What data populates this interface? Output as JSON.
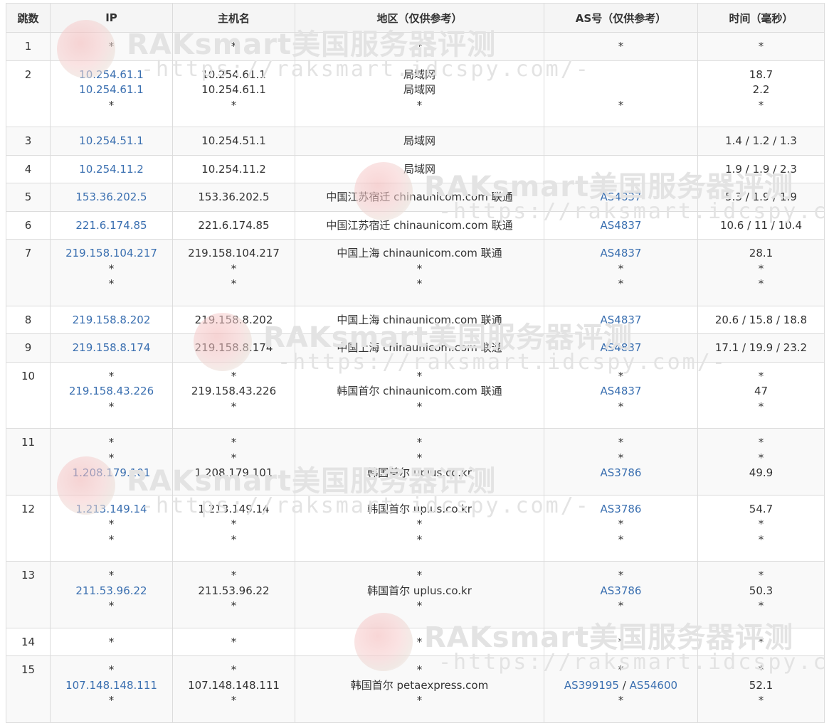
{
  "headers": [
    "跳数",
    "IP",
    "主机名",
    "地区（仅供参考）",
    "AS号（仅供参考）",
    "时间（毫秒）"
  ],
  "watermark": {
    "title": "RAKsmart美国服务器评测",
    "url": "-https://raksmart.idcspy.com/-"
  },
  "rows": [
    {
      "hop": "1",
      "ip": [
        "*"
      ],
      "host": [
        "*"
      ],
      "region": [
        "*"
      ],
      "as": [
        [
          "*"
        ]
      ],
      "time": [
        "*"
      ]
    },
    {
      "hop": "2",
      "ip": [
        "10.254.61.1",
        "10.254.61.1",
        "*"
      ],
      "host": [
        "10.254.61.1",
        "10.254.61.1",
        "*"
      ],
      "region": [
        "局域网",
        "局域网",
        "*"
      ],
      "as": [
        [
          ""
        ],
        [
          ""
        ],
        [
          "*"
        ]
      ],
      "time": [
        "18.7",
        "2.2",
        "*"
      ]
    },
    {
      "hop": "3",
      "ip": [
        "10.254.51.1"
      ],
      "host": [
        "10.254.51.1"
      ],
      "region": [
        "局域网"
      ],
      "as": [
        [
          ""
        ]
      ],
      "time": [
        "1.4 / 1.2 / 1.3"
      ]
    },
    {
      "hop": "4",
      "ip": [
        "10.254.11.2"
      ],
      "host": [
        "10.254.11.2"
      ],
      "region": [
        "局域网"
      ],
      "as": [
        [
          ""
        ]
      ],
      "time": [
        "1.9 / 1.9 / 2.3"
      ]
    },
    {
      "hop": "5",
      "ip": [
        "153.36.202.5"
      ],
      "host": [
        "153.36.202.5"
      ],
      "region": [
        "中国江苏宿迁 chinaunicom.com 联通"
      ],
      "as": [
        [
          "AS4837"
        ]
      ],
      "time": [
        "5.3 / 1.9 / 1.9"
      ]
    },
    {
      "hop": "6",
      "ip": [
        "221.6.174.85"
      ],
      "host": [
        "221.6.174.85"
      ],
      "region": [
        "中国江苏宿迁 chinaunicom.com 联通"
      ],
      "as": [
        [
          "AS4837"
        ]
      ],
      "time": [
        "10.6 / 11 / 10.4"
      ]
    },
    {
      "hop": "7",
      "ip": [
        "219.158.104.217",
        "*",
        "*"
      ],
      "host": [
        "219.158.104.217",
        "*",
        "*"
      ],
      "region": [
        "中国上海 chinaunicom.com 联通",
        "*",
        "*"
      ],
      "as": [
        [
          "AS4837"
        ],
        [
          "*"
        ],
        [
          "*"
        ]
      ],
      "time": [
        "28.1",
        "*",
        "*"
      ]
    },
    {
      "hop": "8",
      "ip": [
        "219.158.8.202"
      ],
      "host": [
        "219.158.8.202"
      ],
      "region": [
        "中国上海 chinaunicom.com 联通"
      ],
      "as": [
        [
          "AS4837"
        ]
      ],
      "time": [
        "20.6 / 15.8 / 18.8"
      ]
    },
    {
      "hop": "9",
      "ip": [
        "219.158.8.174"
      ],
      "host": [
        "219.158.8.174"
      ],
      "region": [
        "中国上海 chinaunicom.com 联通"
      ],
      "as": [
        [
          "AS4837"
        ]
      ],
      "time": [
        "17.1 / 19.9 / 23.2"
      ]
    },
    {
      "hop": "10",
      "ip": [
        "*",
        "219.158.43.226",
        "*"
      ],
      "host": [
        "*",
        "219.158.43.226",
        "*"
      ],
      "region": [
        "*",
        "韩国首尔 chinaunicom.com 联通",
        "*"
      ],
      "as": [
        [
          "*"
        ],
        [
          "AS4837"
        ],
        [
          "*"
        ]
      ],
      "time": [
        "*",
        "47",
        "*"
      ]
    },
    {
      "hop": "11",
      "ip": [
        "*",
        "*",
        "1.208.179.101"
      ],
      "host": [
        "*",
        "*",
        "1.208.179.101"
      ],
      "region": [
        "*",
        "*",
        "韩国首尔 uplus.co.kr"
      ],
      "as": [
        [
          "*"
        ],
        [
          "*"
        ],
        [
          "AS3786"
        ]
      ],
      "time": [
        "*",
        "*",
        "49.9"
      ]
    },
    {
      "hop": "12",
      "ip": [
        "1.213.149.14",
        "*",
        "*"
      ],
      "host": [
        "1.213.149.14",
        "*",
        "*"
      ],
      "region": [
        "韩国首尔 uplus.co.kr",
        "*",
        "*"
      ],
      "as": [
        [
          "AS3786"
        ],
        [
          "*"
        ],
        [
          "*"
        ]
      ],
      "time": [
        "54.7",
        "*",
        "*"
      ]
    },
    {
      "hop": "13",
      "ip": [
        "*",
        "211.53.96.22",
        "*"
      ],
      "host": [
        "*",
        "211.53.96.22",
        "*"
      ],
      "region": [
        "*",
        "韩国首尔 uplus.co.kr",
        "*"
      ],
      "as": [
        [
          "*"
        ],
        [
          "AS3786"
        ],
        [
          "*"
        ]
      ],
      "time": [
        "*",
        "50.3",
        "*"
      ]
    },
    {
      "hop": "14",
      "ip": [
        "*"
      ],
      "host": [
        "*"
      ],
      "region": [
        "*"
      ],
      "as": [
        [
          "*"
        ]
      ],
      "time": [
        "*"
      ]
    },
    {
      "hop": "15",
      "ip": [
        "*",
        "107.148.148.111",
        "*"
      ],
      "host": [
        "*",
        "107.148.148.111",
        "*"
      ],
      "region": [
        "*",
        "韩国首尔 petaexpress.com",
        "*"
      ],
      "as": [
        [
          "*"
        ],
        [
          "AS399195",
          "AS54600"
        ],
        [
          "*"
        ]
      ],
      "time": [
        "*",
        "52.1",
        "*"
      ]
    }
  ]
}
